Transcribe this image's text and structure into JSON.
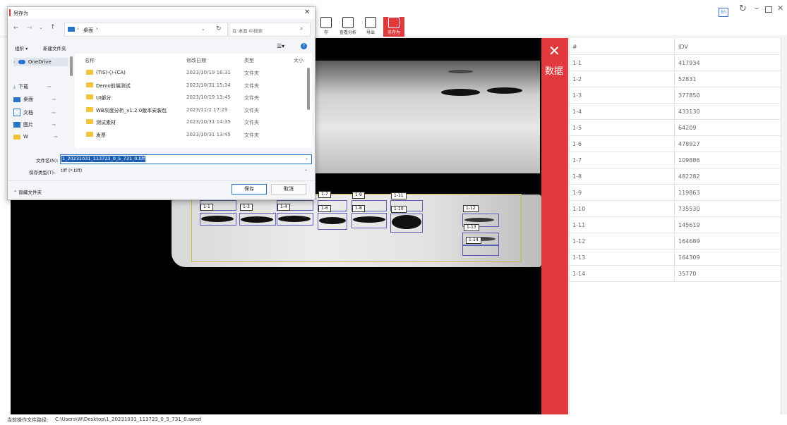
{
  "appbar": {
    "lang_badge": "En",
    "toolbar": [
      {
        "label": "存",
        "icon": "save-icon"
      },
      {
        "label": "查看分析",
        "icon": "analysis-view-icon"
      },
      {
        "label": "导出",
        "icon": "export-icon"
      },
      {
        "label": "另存为",
        "icon": "save-as-icon"
      }
    ]
  },
  "dialog": {
    "title": "另存为",
    "breadcrumb": "桌面",
    "breadcrumb_sep": "›",
    "search_placeholder": "在 桌面 中搜索",
    "organize": "组织 ▾",
    "new_folder": "新建文件夹",
    "sidebar": [
      {
        "label": "OneDrive",
        "icon": "cloud-icon"
      },
      {
        "label": "下载",
        "icon": "download-icon"
      },
      {
        "label": "桌面",
        "icon": "desktop-icon"
      },
      {
        "label": "文档",
        "icon": "document-icon"
      },
      {
        "label": "图片",
        "icon": "picture-icon"
      },
      {
        "label": "W",
        "icon": "folder-icon"
      }
    ],
    "columns": {
      "name": "名称",
      "date": "修改日期",
      "type": "类型",
      "size": "大小"
    },
    "files": [
      {
        "name": "(TIS)-()-(CA)",
        "date": "2023/10/19 16:31",
        "type": "文件夹"
      },
      {
        "name": "Demo前端测试",
        "date": "2023/10/31 15:34",
        "type": "文件夹"
      },
      {
        "name": "UI部分",
        "date": "2023/10/19 13:45",
        "type": "文件夹"
      },
      {
        "name": "WB灰度分析_v1.2.0版本安装包",
        "date": "2023/11/2 17:29",
        "type": "文件夹"
      },
      {
        "name": "测试素材",
        "date": "2023/10/31 14:35",
        "type": "文件夹"
      },
      {
        "name": "发票",
        "date": "2023/10/31 13:45",
        "type": "文件夹"
      }
    ],
    "filename_label": "文件名(N):",
    "filename_value": "1_20231031_113723_0_5_731_0.tiff",
    "filetype_label": "保存类型(T):",
    "filetype_value": "tiff (*.tiff)",
    "hide_folders": "隐藏文件夹",
    "save_button": "保存",
    "cancel_button": "取消"
  },
  "blot_labels": [
    "1-1",
    "1-3",
    "1-4",
    "1-7",
    "1-6",
    "1-9",
    "1-8",
    "1-11",
    "1-10",
    "1-12",
    "1-13",
    "1-14"
  ],
  "panel": {
    "close": "✕",
    "title": "数据"
  },
  "table": {
    "headers": [
      "#",
      "IDV"
    ],
    "rows": [
      [
        "1-1",
        "417934"
      ],
      [
        "1-2",
        "52831"
      ],
      [
        "1-3",
        "377850"
      ],
      [
        "1-4",
        "433130"
      ],
      [
        "1-5",
        "64209"
      ],
      [
        "1-6",
        "478927"
      ],
      [
        "1-7",
        "109886"
      ],
      [
        "1-8",
        "482282"
      ],
      [
        "1-9",
        "119863"
      ],
      [
        "1-10",
        "735530"
      ],
      [
        "1-11",
        "145619"
      ],
      [
        "1-12",
        "164689"
      ],
      [
        "1-13",
        "164309"
      ],
      [
        "1-14",
        "35770"
      ]
    ]
  },
  "status": {
    "label": "当前操作文件路径:",
    "path": "C:\\Users\\W\\Desktop\\1_20231031_113723_0_5_731_0.swed"
  },
  "colors": {
    "accent_red": "#e0393e",
    "selection_blue": "#1a5fb4",
    "box_blue": "#5b5db8"
  }
}
